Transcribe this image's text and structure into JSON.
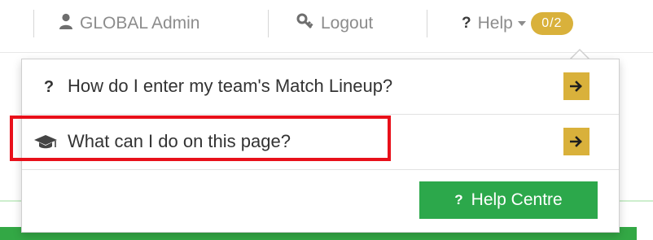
{
  "nav": {
    "user_label": "GLOBAL Admin",
    "logout_label": "Logout",
    "help_label": "Help",
    "help_badge": "0/2"
  },
  "dropdown": {
    "items": [
      {
        "icon": "question-icon",
        "label": "How do I enter my team's Match Lineup?"
      },
      {
        "icon": "graduation-cap-icon",
        "label": "What can I do on this page?"
      }
    ],
    "help_centre_icon": "?",
    "help_centre_label": "Help Centre"
  },
  "colors": {
    "accent_gold": "#d9b13b",
    "help_centre_green": "#2ca84b",
    "highlight_red": "#e8101a",
    "nav_text": "#8c8c8c"
  }
}
